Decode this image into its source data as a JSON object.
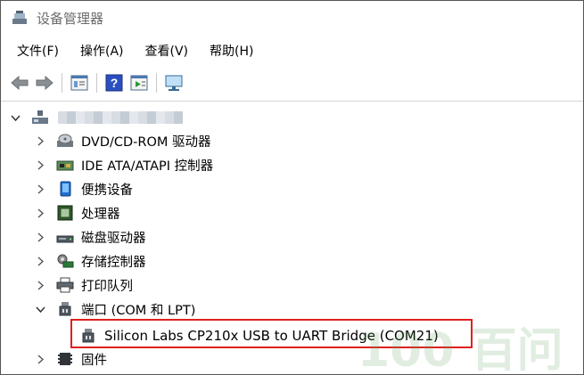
{
  "window": {
    "title": "设备管理器"
  },
  "menu": [
    "文件(F)",
    "操作(A)",
    "查看(V)",
    "帮助(H)"
  ],
  "toolbar": [
    "back-arrow-icon",
    "forward-arrow-icon",
    "properties-icon",
    "help-icon",
    "action-icon",
    "monitor-icon"
  ],
  "tree": {
    "root_label": "",
    "categories": [
      {
        "label": "DVD/CD-ROM 驱动器",
        "expanded": false,
        "icon": "dvd-drive-icon"
      },
      {
        "label": "IDE ATA/ATAPI 控制器",
        "expanded": false,
        "icon": "ide-controller-icon"
      },
      {
        "label": "便携设备",
        "expanded": false,
        "icon": "portable-device-icon"
      },
      {
        "label": "处理器",
        "expanded": false,
        "icon": "processor-icon"
      },
      {
        "label": "磁盘驱动器",
        "expanded": false,
        "icon": "disk-drive-icon"
      },
      {
        "label": "存储控制器",
        "expanded": false,
        "icon": "storage-controller-icon"
      },
      {
        "label": "打印队列",
        "expanded": false,
        "icon": "printer-icon"
      },
      {
        "label": "端口 (COM 和 LPT)",
        "expanded": true,
        "icon": "port-icon"
      },
      {
        "label": "固件",
        "expanded": false,
        "icon": "firmware-icon"
      }
    ],
    "port_child": {
      "label": "Silicon Labs CP210x USB to UART Bridge (COM21)",
      "icon": "port-icon"
    }
  },
  "watermark_text": "100 百问"
}
